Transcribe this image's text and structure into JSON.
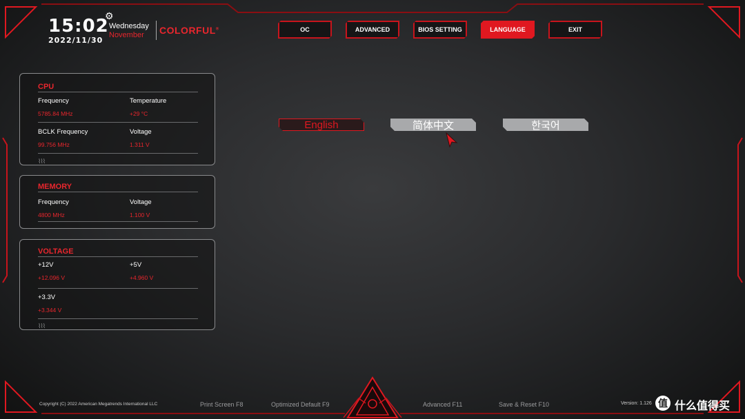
{
  "header": {
    "time": "15:02",
    "date": "2022/11/30",
    "weekday": "Wednesday",
    "month": "November",
    "brand": "COLORFUL",
    "brand_mark": "®"
  },
  "nav": {
    "items": [
      {
        "label": "OC",
        "active": false
      },
      {
        "label": "ADVANCED",
        "active": false
      },
      {
        "label": "BIOS SETTING",
        "active": false
      },
      {
        "label": "LANGUAGE",
        "active": true
      },
      {
        "label": "EXIT",
        "active": false
      }
    ]
  },
  "cpu": {
    "title": "CPU",
    "frequency_label": "Frequency",
    "frequency_value": "5785.84 MHz",
    "temperature_label": "Temperature",
    "temperature_value": "+29 °C",
    "bclk_label": "BCLK Frequency",
    "bclk_value": "99.756 MHz",
    "voltage_label": "Voltage",
    "voltage_value": "1.311 V"
  },
  "memory": {
    "title": "MEMORY",
    "frequency_label": "Frequency",
    "frequency_value": "4800 MHz",
    "voltage_label": "Voltage",
    "voltage_value": "1.100 V"
  },
  "voltage": {
    "title": "VOLTAGE",
    "v12_label": "+12V",
    "v12_value": "+12.096 V",
    "v5_label": "+5V",
    "v5_value": "+4.960 V",
    "v33_label": "+3.3V",
    "v33_value": "+3.344 V"
  },
  "languages": {
    "english": "English",
    "chinese": "简体中文",
    "korean": "한국어",
    "selected": "English"
  },
  "footer": {
    "copyright": "Copyright (C) 2022 American Megatrends International LLC",
    "print_screen": "Print Screen F8",
    "optimized_default": "Optimized Default F9",
    "advanced": "Advanced F11",
    "save_reset": "Save & Reset F10",
    "version": "Version: 1.126"
  },
  "watermark": {
    "icon_char": "值",
    "text": "什么值得买"
  },
  "colors": {
    "accent": "#e01820",
    "panel_border": "#8a8b8d",
    "button_inactive": "#a8a9ab"
  }
}
